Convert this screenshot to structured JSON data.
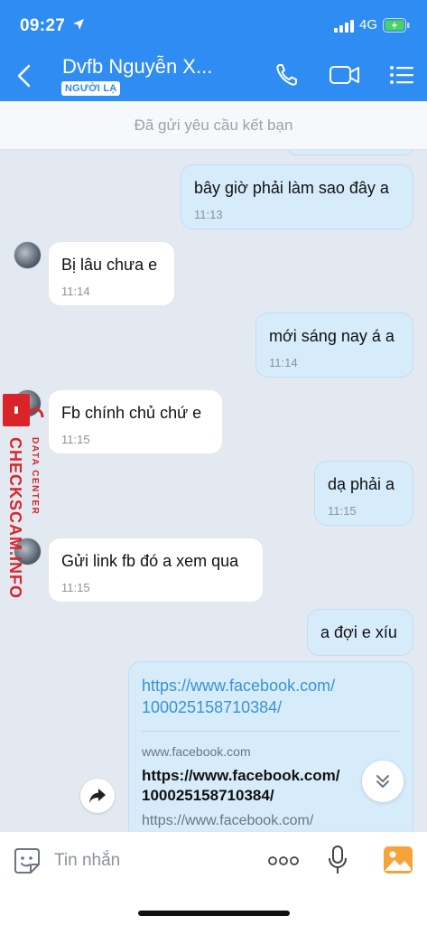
{
  "status": {
    "time": "09:27",
    "network": "4G"
  },
  "header": {
    "title": "Dvfb Nguyễn X...",
    "badge": "NGƯỜI LẠ"
  },
  "friend_request": "Đã gửi yêu cầu kết bạn",
  "messages": [
    {
      "text": "bây giờ phải làm sao đây a",
      "time": "11:13"
    },
    {
      "text": "Bị lâu chưa e",
      "time": "11:14"
    },
    {
      "text": "mới sáng nay á a",
      "time": "11:14"
    },
    {
      "text": "Fb chính chủ chứ e",
      "time": "11:15"
    },
    {
      "text": "dạ phải a",
      "time": "11:15"
    },
    {
      "text": "Gửi link fb đó a xem qua",
      "time": "11:15"
    },
    {
      "text": "a đợi e xíu"
    }
  ],
  "link_card": {
    "url_line1": "https://www.facebook.com/",
    "url_line2": "100025158710384/",
    "domain": "www.facebook.com",
    "title_line1": "https://www.facebook.com/",
    "title_line2": "100025158710384/",
    "url_repeat": "https://www.facebook.com/"
  },
  "watermark": {
    "main": "CHECKSCAM.INFO",
    "sub": "DATA CENTER"
  },
  "input": {
    "placeholder": "Tin nhắn"
  },
  "colors": {
    "header": "#2f8cf3",
    "outgoing_bubble": "#d6ecfb",
    "incoming_bubble": "#ffffff",
    "watermark": "#d9242a"
  }
}
